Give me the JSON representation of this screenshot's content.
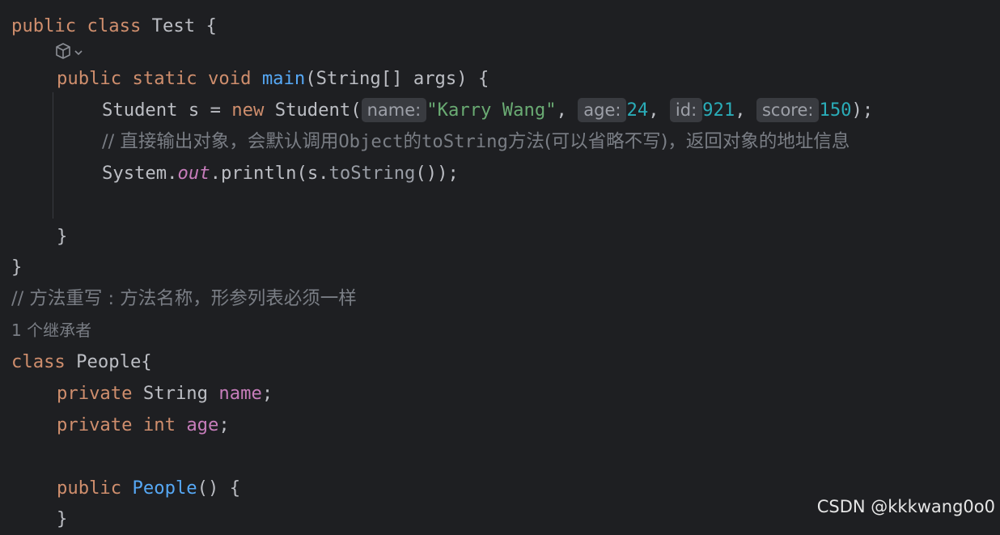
{
  "code": {
    "l1": {
      "kw1": "public",
      "kw2": "class",
      "name": "Test",
      "brace": "{"
    },
    "main": {
      "kw1": "public",
      "kw2": "static",
      "kw3": "void",
      "fn": "main",
      "params": "(String[] args) {"
    },
    "student": {
      "prefix": "Student s = ",
      "kw_new": "new",
      "ctor": " Student(",
      "hint_name": "name:",
      "val_name": "\"Karry Wang\"",
      "sep1": ", ",
      "hint_age": "age:",
      "val_age": "24",
      "sep2": ", ",
      "hint_id": "id:",
      "val_id": "921",
      "sep3": ", ",
      "hint_score": "score:",
      "val_score": "150",
      "end": ");"
    },
    "comment1_a": "// 直接输出对象，会默认调用",
    "comment1_b": "Object",
    "comment1_c": "的",
    "comment1_d": "toString",
    "comment1_e": "方法(可以省略不写)，返回对象的地址信息",
    "println": {
      "prefix": "System.",
      "field": "out",
      "mid": ".println(s.",
      "call": "toString",
      "end": "());"
    },
    "close_main": "}",
    "close_class": "}",
    "comment2": "// 方法重写 : 方法名称，形参列表必须一样",
    "inheritors": "1 个继承者",
    "people": {
      "kw": "class",
      "rest": " People{"
    },
    "name_decl": {
      "kw": "private",
      "type": " String ",
      "field": "name",
      "end": ";"
    },
    "age_decl": {
      "kw1": "private",
      "kw2": "int",
      "field": "age",
      "end": ";"
    },
    "ctor": {
      "kw": "public",
      "fn": "People",
      "end": "() {"
    },
    "ctor_close": "}"
  },
  "lens_icon": "ai-assistant-icon",
  "lens_caret": "⌄",
  "watermark": "CSDN @kkkwang0o0",
  "colors": {
    "background": "#1e1f22",
    "keyword": "#cf8e6d",
    "function": "#56a8f5",
    "string": "#6aab73",
    "number": "#2aacb8",
    "field": "#c77dbb",
    "comment": "#7a7e85",
    "text": "#bcbec4"
  }
}
